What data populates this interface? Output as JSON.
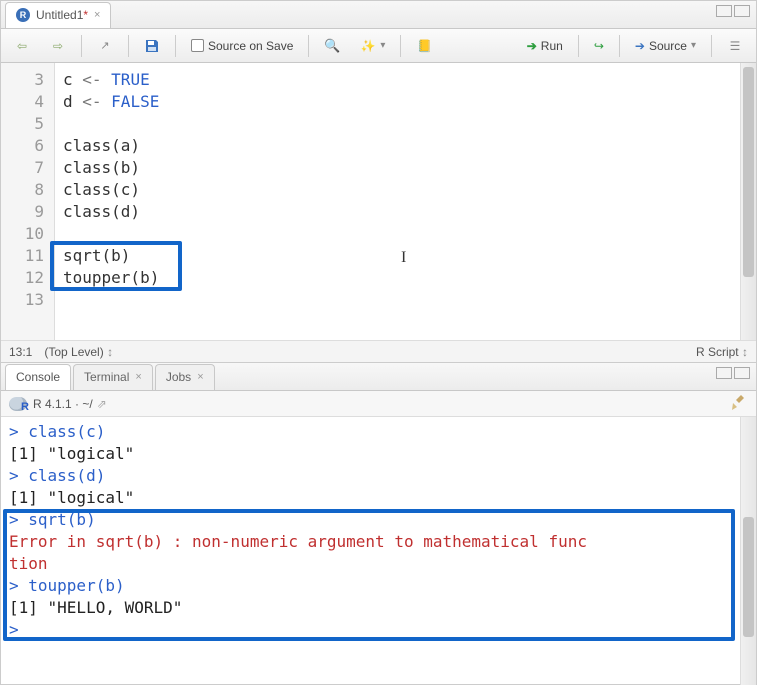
{
  "editor": {
    "tab_title": "Untitled1",
    "tab_unsaved_marker": "*",
    "toolbar": {
      "source_on_save_label": "Source on Save",
      "run_label": "Run",
      "source_label": "Source"
    },
    "gutter_lines": [
      "3",
      "4",
      "5",
      "6",
      "7",
      "8",
      "9",
      "10",
      "11",
      "12",
      "13"
    ],
    "code_lines": [
      {
        "plain": "c ",
        "op": "<-",
        "after": " ",
        "const": "TRUE"
      },
      {
        "plain": "d ",
        "op": "<-",
        "after": " ",
        "const": "FALSE"
      },
      {
        "plain": ""
      },
      {
        "plain": "class(a)"
      },
      {
        "plain": "class(b)"
      },
      {
        "plain": "class(c)"
      },
      {
        "plain": "class(d)"
      },
      {
        "plain": ""
      },
      {
        "plain": "sqrt(b)"
      },
      {
        "plain": "toupper(b)"
      },
      {
        "plain": ""
      }
    ],
    "statusbar": {
      "cursor_pos": "13:1",
      "scope": "(Top Level)",
      "file_type": "R Script"
    }
  },
  "console": {
    "tabs": {
      "console": "Console",
      "terminal": "Terminal",
      "jobs": "Jobs"
    },
    "header_text": "R 4.1.1 · ~/",
    "lines": [
      {
        "cls": "prompt",
        "text": "> class(c)"
      },
      {
        "cls": "out",
        "text": "[1] \"logical\""
      },
      {
        "cls": "prompt",
        "text": "> class(d)"
      },
      {
        "cls": "out",
        "text": "[1] \"logical\""
      },
      {
        "cls": "prompt",
        "text": "> sqrt(b)"
      },
      {
        "cls": "err",
        "text": "Error in sqrt(b) : non-numeric argument to mathematical func"
      },
      {
        "cls": "err",
        "text": "tion"
      },
      {
        "cls": "prompt",
        "text": "> toupper(b)"
      },
      {
        "cls": "out",
        "text": "[1] \"HELLO, WORLD\""
      },
      {
        "cls": "prompt",
        "text": "> "
      }
    ]
  },
  "icons": {
    "close": "×"
  }
}
